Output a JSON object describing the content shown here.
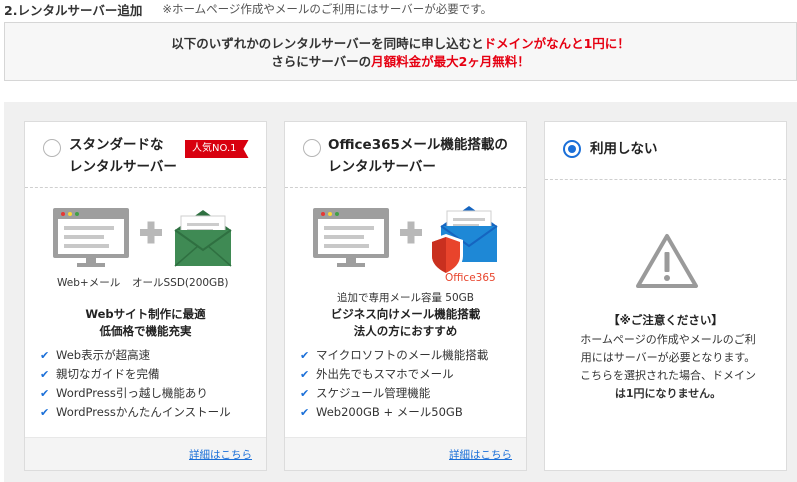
{
  "section": {
    "title": "2.レンタルサーバー追加",
    "note": "※ホームページ作成やメールのご利用にはサーバーが必要です。"
  },
  "promo": {
    "line1_pre": "以下のいずれかのレンタルサーバーを同時に申し込むと",
    "line1_hl": "ドメインがなんと1円に！",
    "line2_pre": "さらにサーバーの",
    "line2_hl": "月額料金が最大2ヶ月無料！"
  },
  "colors": {
    "accent": "#1a6fd8",
    "highlight": "#e60012",
    "badge": "#d8000f",
    "envelope": "#3f8a54",
    "mail_blue": "#1e88d6",
    "shield": "#e8442c"
  },
  "options": [
    {
      "title_l1": "スタンダードな",
      "title_l2": "レンタルサーバー",
      "badge": "人気NO.1",
      "caption_left": "Web+メール",
      "caption_right": "オールSSD(200GB)",
      "heading_l1": "Webサイト制作に最適",
      "heading_l2": "低価格で機能充実",
      "features": [
        "Web表示が超高速",
        "親切なガイドを完備",
        "WordPress引っ越し機能あり",
        "WordPressかんたんインストール"
      ],
      "link": "詳細はこちら",
      "selected": false
    },
    {
      "title_l1": "Office365メール機能搭載の",
      "title_l2": "レンタルサーバー",
      "office_label": "Office365",
      "caption": "追加で専用メール容量 50GB",
      "heading_l1": "ビジネス向けメール機能搭載",
      "heading_l2": "法人の方におすすめ",
      "features": [
        "マイクロソフトのメール機能搭載",
        "外出先でもスマホでメール",
        "スケジュール管理機能",
        "Web200GB + メール50GB"
      ],
      "link": "詳細はこちら",
      "selected": false
    },
    {
      "title": "利用しない",
      "notice_title": "【※ご注意ください】",
      "notice_l1": "ホームページの作成やメールのご利",
      "notice_l2": "用にはサーバーが必要となります。",
      "notice_l3": "こちらを選択された場合、ドメイン",
      "notice_l4": "は1円になりません。",
      "selected": true
    }
  ]
}
